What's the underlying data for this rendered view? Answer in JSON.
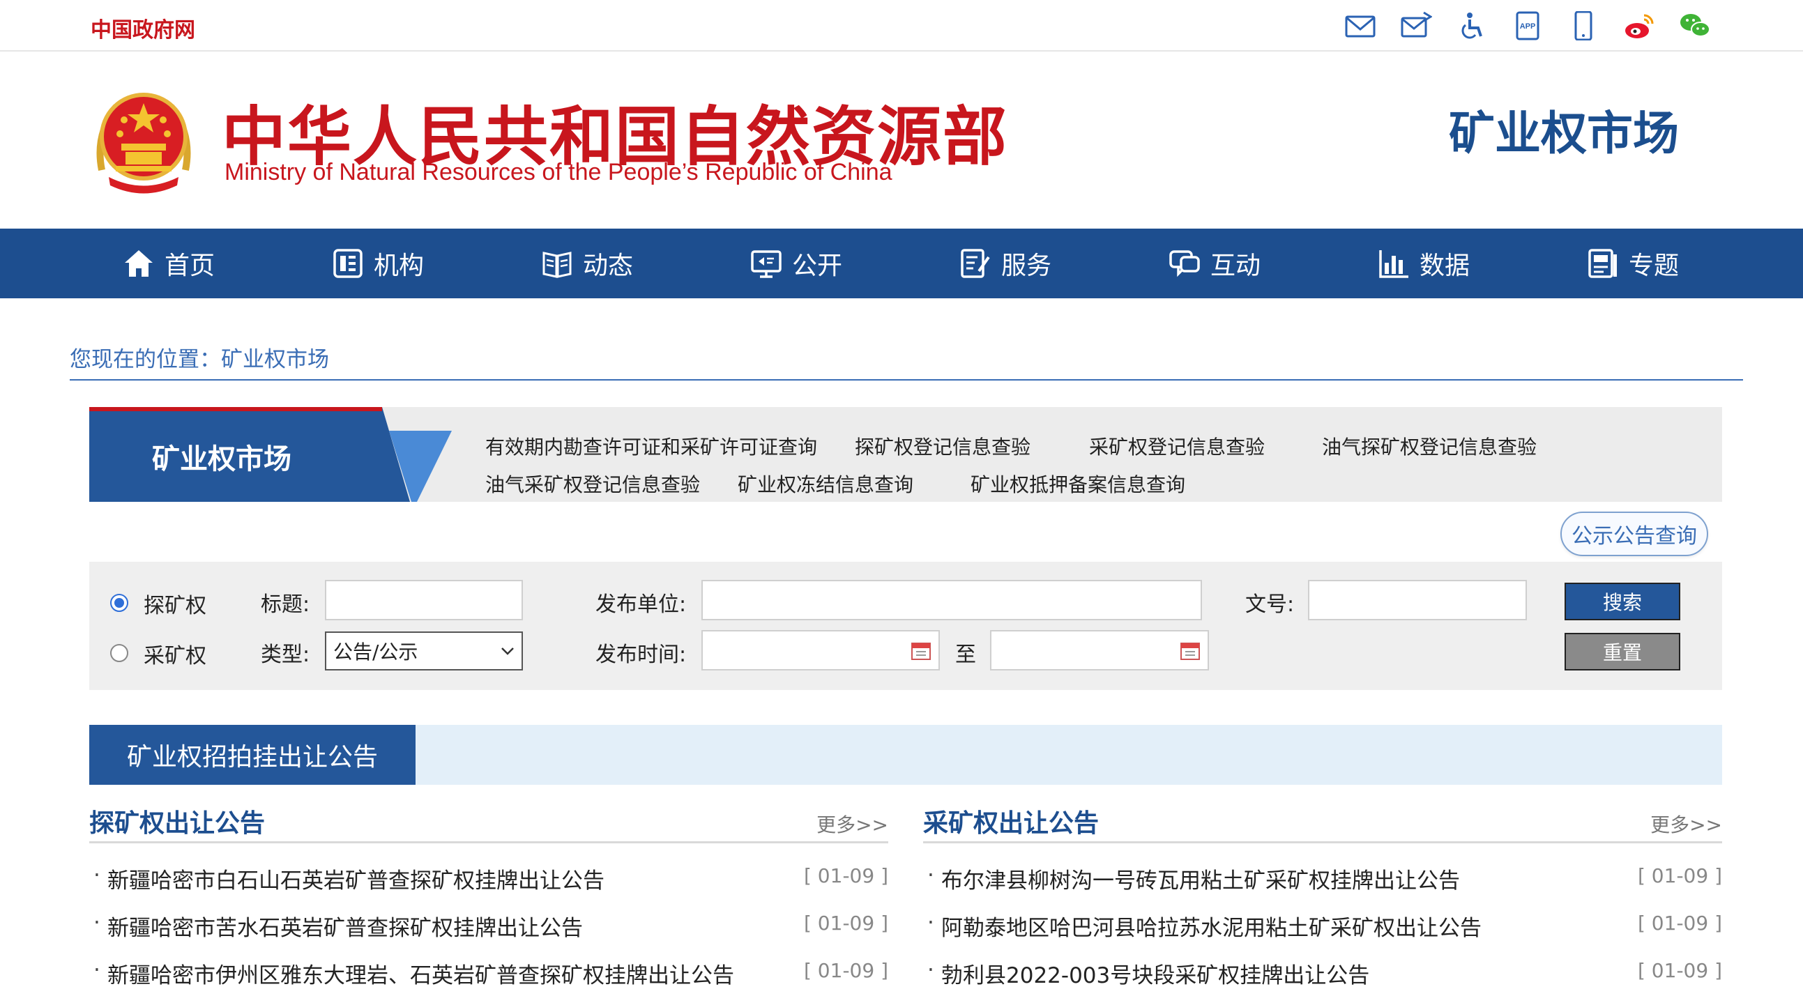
{
  "topbar": {
    "gov_link": "中国政府网",
    "icons": [
      "mail-icon",
      "mail-open-icon",
      "accessibility-icon",
      "app-icon",
      "mobile-icon",
      "weibo-icon",
      "wechat-icon"
    ],
    "app_badge": "APP"
  },
  "header": {
    "title_cn": "中华人民共和国自然资源部",
    "title_en": "Ministry of Natural Resources of the People’s Republic of China",
    "section_title": "矿业权市场"
  },
  "nav": {
    "items": [
      {
        "label": "首页",
        "icon": "home-icon"
      },
      {
        "label": "机构",
        "icon": "org-icon"
      },
      {
        "label": "动态",
        "icon": "news-icon"
      },
      {
        "label": "公开",
        "icon": "disclosure-icon"
      },
      {
        "label": "服务",
        "icon": "service-icon"
      },
      {
        "label": "互动",
        "icon": "chat-icon"
      },
      {
        "label": "数据",
        "icon": "chart-icon"
      },
      {
        "label": "专题",
        "icon": "topic-icon"
      }
    ]
  },
  "breadcrumb": {
    "prefix": "您现在的位置：",
    "current": "矿业权市场"
  },
  "market": {
    "tab_label": "矿业权市场",
    "links": [
      "有效期内勘查许可证和采矿许可证查询",
      "探矿权登记信息查验",
      "采矿权登记信息查验",
      "油气探矿权登记信息查验",
      "油气采矿权登记信息查验",
      "矿业权冻结信息查询",
      "矿业权抵押备案信息查询"
    ],
    "notice_button": "公示公告查询"
  },
  "search": {
    "radio_exploration": "探矿权",
    "radio_mining": "采矿权",
    "title_label": "标题:",
    "type_label": "类型:",
    "type_value": "公告/公示",
    "publisher_label": "发布单位:",
    "date_label": "发布时间:",
    "to_label": "至",
    "doc_no_label": "文号:",
    "search_button": "搜索",
    "reset_button": "重置"
  },
  "tender": {
    "tab_label": "矿业权招拍挂出让公告"
  },
  "lists": {
    "more_label": "更多>>",
    "exploration": {
      "title": "探矿权出让公告",
      "items": [
        {
          "title": "新疆哈密市白石山石英岩矿普查探矿权挂牌出让公告",
          "date": "[ 01-09 ]"
        },
        {
          "title": "新疆哈密市苦水石英岩矿普查探矿权挂牌出让公告",
          "date": "[ 01-09 ]"
        },
        {
          "title": "新疆哈密市伊州区雅东大理岩、石英岩矿普查探矿权挂牌出让公告",
          "date": "[ 01-09 ]"
        }
      ]
    },
    "mining": {
      "title": "采矿权出让公告",
      "items": [
        {
          "title": "布尔津县柳树沟一号砖瓦用粘土矿采矿权挂牌出让公告",
          "date": "[ 01-09 ]"
        },
        {
          "title": "阿勒泰地区哈巴河县哈拉苏水泥用粘土矿采矿权出让公告",
          "date": "[ 01-09 ]"
        },
        {
          "title": "勃利县2022-003号块段采矿权挂牌出让公告",
          "date": "[ 01-09 ]"
        }
      ]
    }
  },
  "colors": {
    "brand_red": "#c8161d",
    "nav_blue": "#1d4e8f",
    "link_blue": "#3a6db5",
    "search_btn": "#24579a",
    "reset_btn": "#8a8a8a"
  }
}
